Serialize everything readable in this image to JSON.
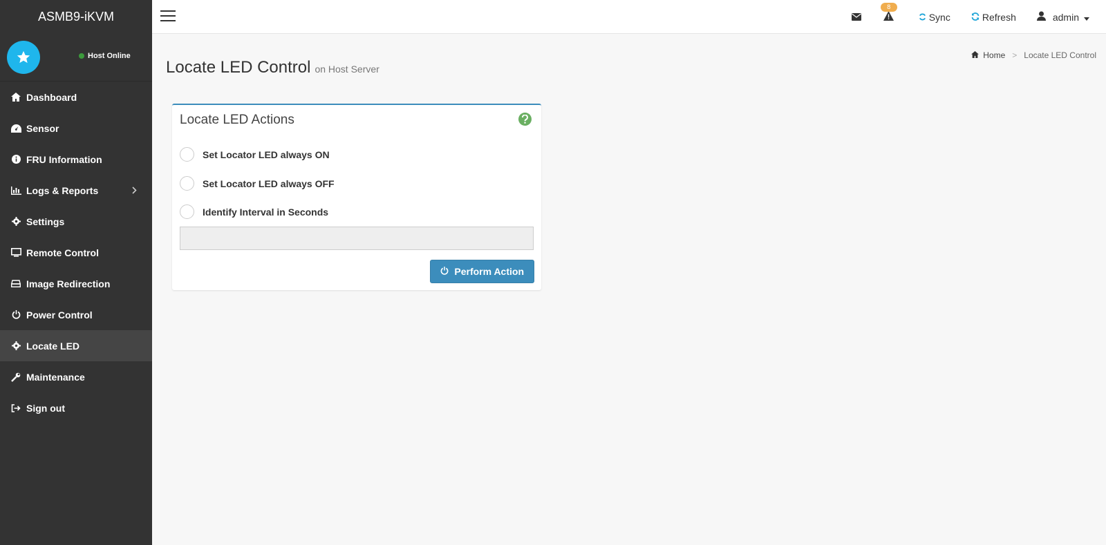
{
  "brand": "ASMB9-iKVM",
  "host_status": "Host Online",
  "sidebar": {
    "items": [
      {
        "label": "Dashboard",
        "icon": "home-icon"
      },
      {
        "label": "Sensor",
        "icon": "dashboard-gauge-icon"
      },
      {
        "label": "FRU Information",
        "icon": "info-circle-icon"
      },
      {
        "label": "Logs & Reports",
        "icon": "bar-chart-icon"
      },
      {
        "label": "Settings",
        "icon": "gear-icon"
      },
      {
        "label": "Remote Control",
        "icon": "monitor-icon"
      },
      {
        "label": "Image Redirection",
        "icon": "hdd-icon"
      },
      {
        "label": "Power Control",
        "icon": "power-icon"
      },
      {
        "label": "Locate LED",
        "icon": "gear-icon"
      },
      {
        "label": "Maintenance",
        "icon": "wrench-icon"
      },
      {
        "label": "Sign out",
        "icon": "sign-out-icon"
      }
    ],
    "active": "Locate LED"
  },
  "header": {
    "alert_count": "8",
    "sync_label": "Sync",
    "refresh_label": "Refresh",
    "user_label": "admin"
  },
  "page": {
    "title": "Locate LED Control",
    "subtitle": "on Host Server"
  },
  "breadcrumb": {
    "home": "Home",
    "current": "Locate LED Control"
  },
  "panel": {
    "title": "Locate LED Actions",
    "options": [
      "Set Locator LED always ON",
      "Set Locator LED always OFF",
      "Identify Interval in Seconds"
    ],
    "interval_value": "",
    "action_button": "Perform Action"
  },
  "colors": {
    "sidebar_bg": "#333333",
    "accent": "#3c8dbc",
    "avatar": "#1fb6ec",
    "badge": "#f0ad4e",
    "status_online": "#3c9a3c",
    "help": "#6aaf62"
  }
}
